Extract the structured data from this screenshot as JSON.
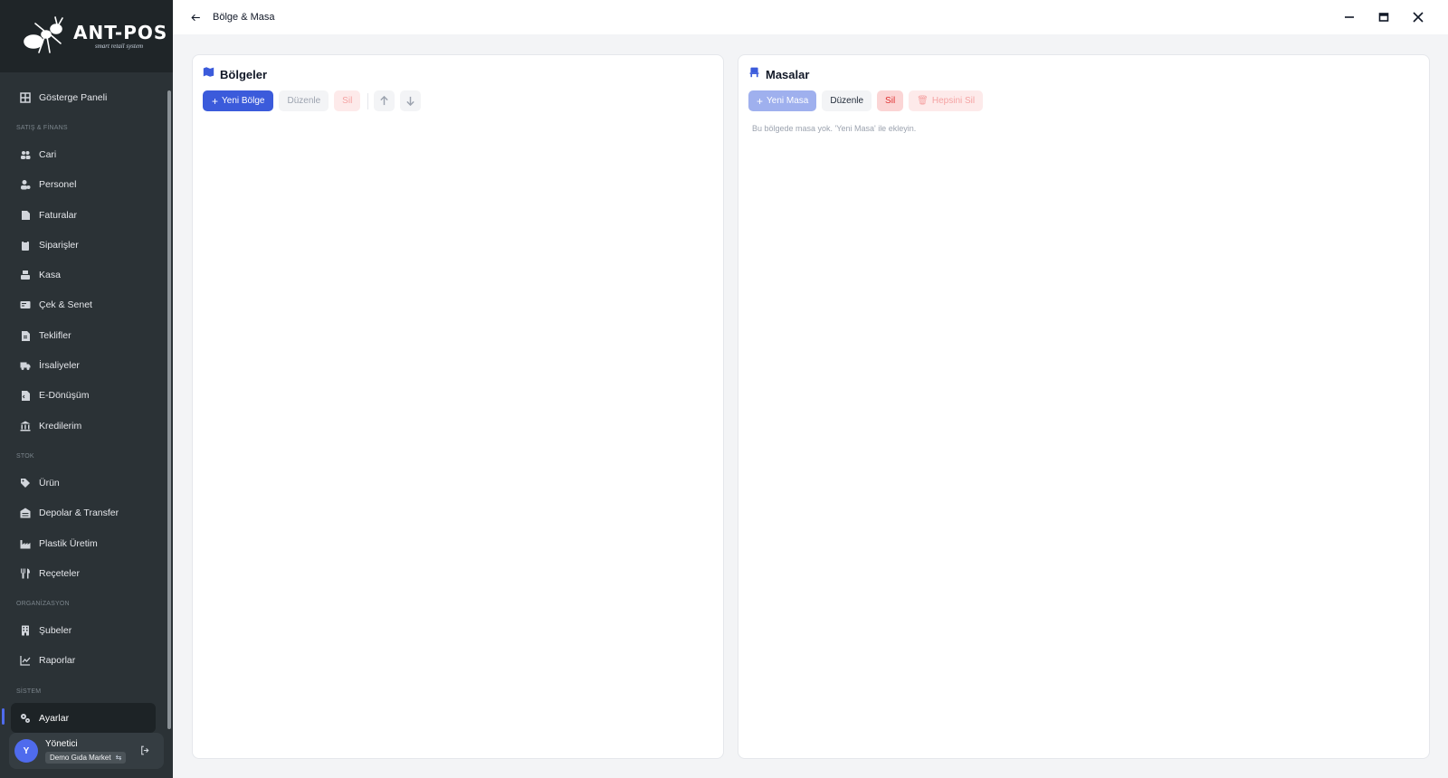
{
  "app": {
    "logo_title": "ANT-POS",
    "logo_subtitle": "smart retail system"
  },
  "sidebar": {
    "items": [
      {
        "type": "item",
        "label": "Gösterge Paneli",
        "icon": "dashboard-icon"
      },
      {
        "type": "section",
        "label": "SATIŞ & FİNANS"
      },
      {
        "type": "item",
        "label": "Cari",
        "icon": "users-icon"
      },
      {
        "type": "item",
        "label": "Personel",
        "icon": "user-gear-icon"
      },
      {
        "type": "item",
        "label": "Faturalar",
        "icon": "invoice-icon"
      },
      {
        "type": "item",
        "label": "Siparişler",
        "icon": "clipboard-icon"
      },
      {
        "type": "item",
        "label": "Kasa",
        "icon": "cash-register-icon"
      },
      {
        "type": "item",
        "label": "Çek & Senet",
        "icon": "money-check-icon"
      },
      {
        "type": "item",
        "label": "Teklifler",
        "icon": "document-icon"
      },
      {
        "type": "item",
        "label": "İrsaliyeler",
        "icon": "truck-icon"
      },
      {
        "type": "item",
        "label": "E-Dönüşüm",
        "icon": "file-code-icon"
      },
      {
        "type": "item",
        "label": "Kredilerim",
        "icon": "bank-icon"
      },
      {
        "type": "section",
        "label": "STOK"
      },
      {
        "type": "item",
        "label": "Ürün",
        "icon": "tag-icon"
      },
      {
        "type": "item",
        "label": "Depolar & Transfer",
        "icon": "warehouse-icon"
      },
      {
        "type": "item",
        "label": "Plastik Üretim",
        "icon": "industry-icon"
      },
      {
        "type": "item",
        "label": "Reçeteler",
        "icon": "utensils-icon"
      },
      {
        "type": "section",
        "label": "ORGANİZASYON"
      },
      {
        "type": "item",
        "label": "Şubeler",
        "icon": "building-icon"
      },
      {
        "type": "item",
        "label": "Raporlar",
        "icon": "chart-line-icon"
      },
      {
        "type": "section",
        "label": "SİSTEM"
      },
      {
        "type": "item",
        "label": "Ayarlar",
        "icon": "gears-icon",
        "active": true
      }
    ],
    "user": {
      "avatar_letter": "Y",
      "name": "Yönetici",
      "company": "Demo Gıda Market"
    }
  },
  "topbar": {
    "title": "Bölge & Masa"
  },
  "regions_panel": {
    "title": "Bölgeler",
    "new_label": "Yeni Bölge",
    "edit_label": "Düzenle",
    "delete_label": "Sil"
  },
  "tables_panel": {
    "title": "Masalar",
    "new_label": "Yeni Masa",
    "edit_label": "Düzenle",
    "delete_label": "Sil",
    "delete_all_label": "Hepsini Sil",
    "empty_message": "Bu bölgede masa yok. 'Yeni Masa' ile ekleyin."
  },
  "colors": {
    "accent": "#3b5bdb",
    "sidebar_bg": "#2b3236",
    "danger": "#e03131"
  }
}
